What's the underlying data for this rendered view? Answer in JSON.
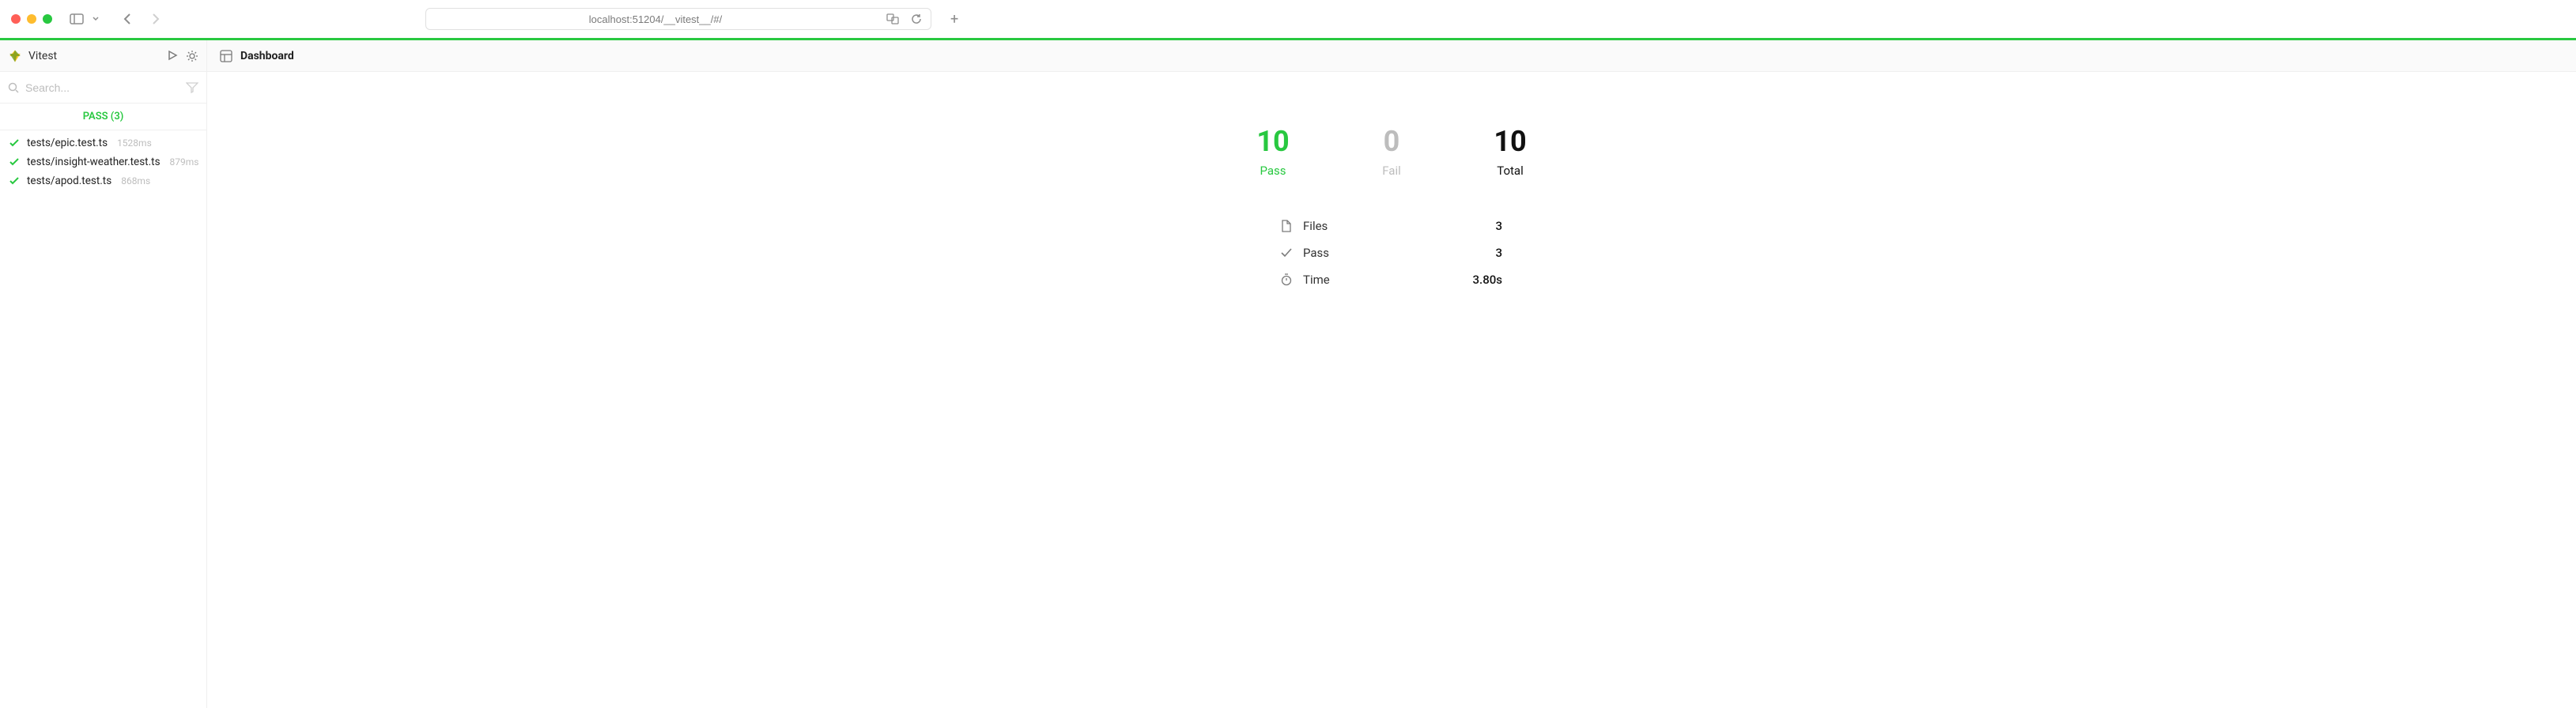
{
  "browser": {
    "url": "localhost:51204/__vitest__/#/"
  },
  "sidebar": {
    "title": "Vitest",
    "search_placeholder": "Search...",
    "tab_label": "PASS (3)",
    "files": [
      {
        "name": "tests/epic.test.ts",
        "duration": "1528ms"
      },
      {
        "name": "tests/insight-weather.test.ts",
        "duration": "879ms"
      },
      {
        "name": "tests/apod.test.ts",
        "duration": "868ms"
      }
    ]
  },
  "main": {
    "title": "Dashboard",
    "summary": {
      "pass_count": "10",
      "pass_label": "Pass",
      "fail_count": "0",
      "fail_label": "Fail",
      "total_count": "10",
      "total_label": "Total"
    },
    "details": {
      "files_label": "Files",
      "files_value": "3",
      "pass_label": "Pass",
      "pass_value": "3",
      "time_label": "Time",
      "time_value": "3.80s"
    }
  }
}
